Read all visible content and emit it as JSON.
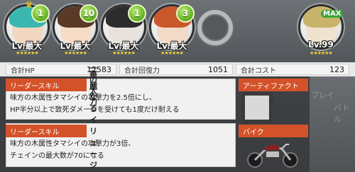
{
  "party": [
    {
      "level_badge": "1",
      "level_text": "Lv.最大",
      "stars": "★★★★★★",
      "face": "#f1d7bf",
      "hair": "#3bb7b0"
    },
    {
      "level_badge": "10",
      "level_text": "Lv.最大",
      "stars": "★★★★★★",
      "face": "#f6dcc7",
      "hair": "#5a3a26"
    },
    {
      "level_badge": "1",
      "level_text": "Lv.最大",
      "stars": "★★★★★★",
      "face": "#e7e2dc",
      "hair": "#2c2c2c"
    },
    {
      "level_badge": "3",
      "level_text": "Lv.最大",
      "stars": "★★★★★★",
      "face": "#f3d9c7",
      "hair": "#c8582a"
    }
  ],
  "helper": {
    "level_text": "Lv.99",
    "max_label": "MAX",
    "stars": "★★★★★★",
    "face": "#efe3cf",
    "hair": "#c7b46a"
  },
  "stats": {
    "hp_label": "合計HP",
    "hp_value": "12583",
    "heal_label": "合計回復力",
    "heal_value": "1051",
    "cost_label": "合計コスト",
    "cost_value": "123"
  },
  "leader_skill": {
    "tag": "リーダースキル",
    "name": "一の太刀",
    "desc1": "味方の木属性タマシイの攻撃力を2.5倍にし、",
    "desc2": "HP半分以上で致死ダメージを受けても1度だけ耐える"
  },
  "sub_leader_skill": {
    "tag": "リーダースキル",
    "name": "華麗なるイリュージョン",
    "desc1": "味方の木属性タマシイの攻撃力が3倍、",
    "desc2": "チェインの最大数が70になる"
  },
  "artifact": {
    "label": "アーティファクト"
  },
  "bike": {
    "label": "バイク"
  },
  "ghost": {
    "a": "プレイ",
    "b": "バトル"
  },
  "colors": {
    "accent": "#d4522a",
    "badge": "#5fae1c",
    "star": "#f7d33a"
  }
}
